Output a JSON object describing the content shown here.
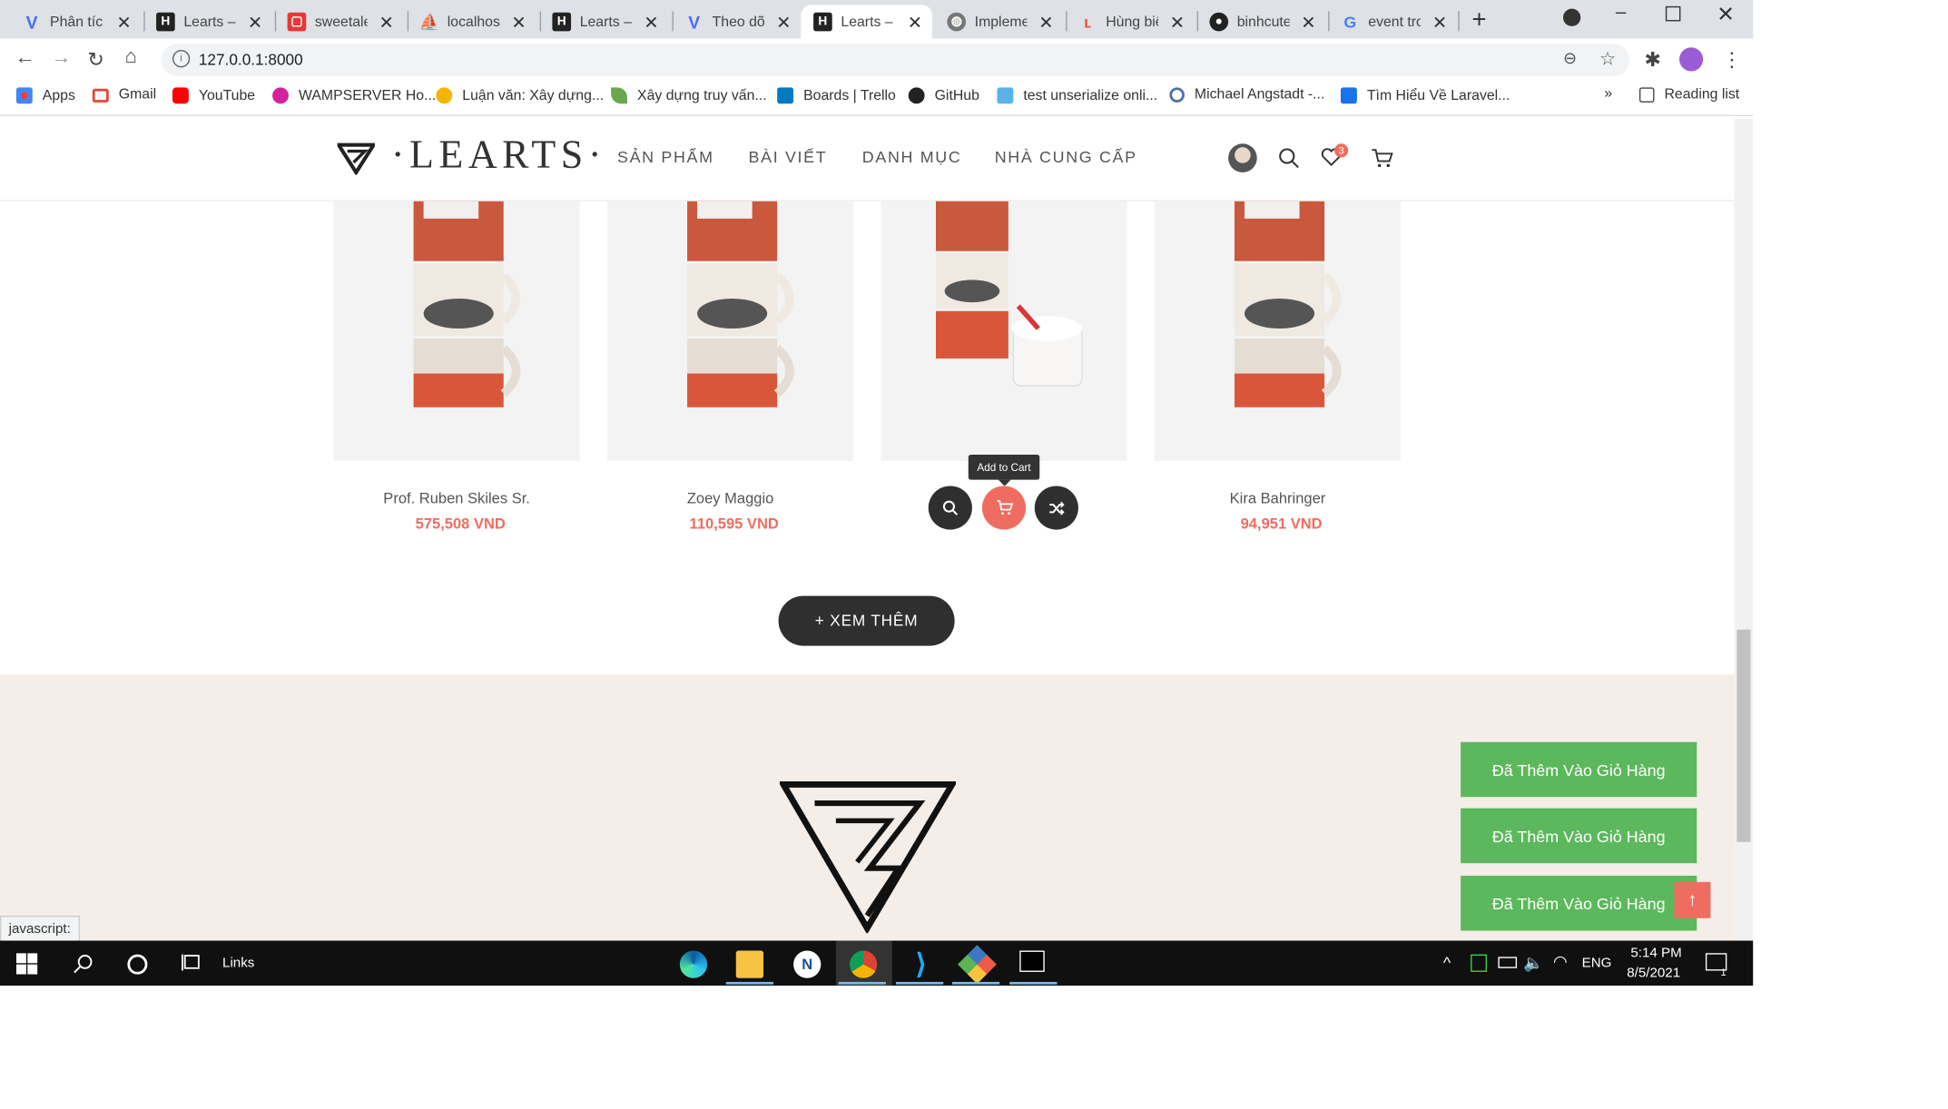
{
  "browser": {
    "tabs": [
      {
        "label": "Phân tích",
        "icon": "v-icon",
        "active": false
      },
      {
        "label": "Learts – H",
        "icon": "learts-icon",
        "active": false
      },
      {
        "label": "sweetaler",
        "icon": "sweetalert-icon",
        "active": false
      },
      {
        "label": "localhost",
        "icon": "phpmyadmin-icon",
        "active": false
      },
      {
        "label": "Learts – H",
        "icon": "learts-icon",
        "active": false
      },
      {
        "label": "Theo dõi",
        "icon": "v-icon",
        "active": false
      },
      {
        "label": "Learts – T",
        "icon": "learts-icon",
        "active": true
      },
      {
        "label": "Implemen",
        "icon": "globe-icon",
        "active": false
      },
      {
        "label": "Hùng biệ",
        "icon": "laravel-icon",
        "active": false
      },
      {
        "label": "binhcute/",
        "icon": "github-icon",
        "active": false
      },
      {
        "label": "event tro",
        "icon": "google-icon",
        "active": false
      }
    ],
    "url": "127.0.0.1:8000",
    "bookmarks": [
      "Apps",
      "Gmail",
      "YouTube",
      "WAMPSERVER Ho...",
      "Luận văn: Xây dựng...",
      "Xây dựng truy vấn...",
      "Boards | Trello",
      "GitHub",
      "test unserialize onli...",
      "Michael Angstadt -...",
      "Tìm Hiểu Về Laravel..."
    ],
    "more_bookmarks": "»",
    "reading_list": "Reading list",
    "status_text": "javascript:"
  },
  "site": {
    "logo": "·LEARTS·",
    "nav": [
      "SẢN PHẨM",
      "BÀI VIẾT",
      "DANH MỤC",
      "NHÀ CUNG CẤP"
    ],
    "wishlist_count": "3",
    "products": [
      {
        "name": "Prof. Ruben Skiles Sr.",
        "price": "575,508 VND"
      },
      {
        "name": "Zoey Maggio",
        "price": "110,595 VND"
      },
      {
        "name": "",
        "price": ""
      },
      {
        "name": "Kira Bahringer",
        "price": "94,951 VND"
      }
    ],
    "tooltip": "Add to Cart",
    "view_more": "+ XEM THÊM",
    "toasts": [
      "Đã Thêm Vào Giỏ Hàng",
      "Đã Thêm Vào Giỏ Hàng",
      "Đã Thêm Vào Giỏ Hàng"
    ]
  },
  "taskbar": {
    "links_label": "Links",
    "language": "ENG",
    "time": "5:14 PM",
    "date": "8/5/2021",
    "notification_count": "1"
  },
  "colors": {
    "accent": "#ef6d60",
    "toast": "#5cb85c",
    "dark_button": "#2f2f2f",
    "footer_bg": "#f4ede8"
  }
}
